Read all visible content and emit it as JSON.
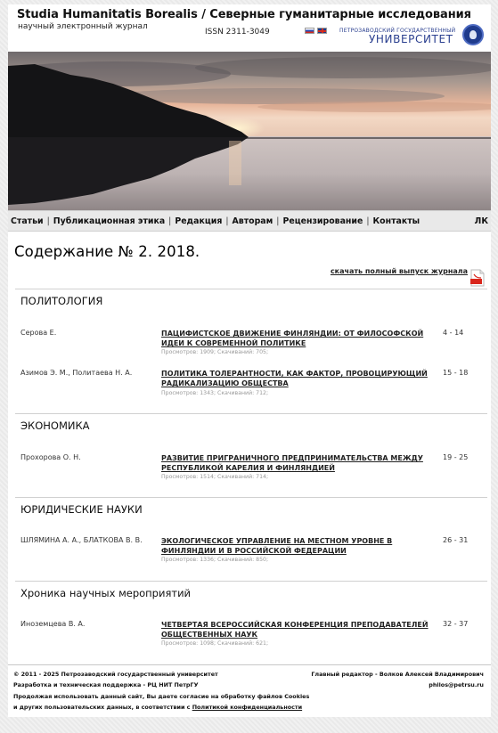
{
  "header": {
    "title": "Studia Humanitatis Borealis / Северные гуманитарные исследования",
    "subtitle": "научный электронный журнал",
    "issn": "ISSN 2311-3049",
    "university_line1": "ПЕТРОЗАВОДСКИЙ ГОСУДАРСТВЕННЫЙ",
    "university_line2": "УНИВЕРСИТЕТ"
  },
  "nav": {
    "items": [
      "Статьи",
      "Публикационная этика",
      "Редакция",
      "Авторам",
      "Рецензирование",
      "Контакты"
    ],
    "separator": "|",
    "account": "ЛК"
  },
  "contents": {
    "title": "Содержание № 2. 2018.",
    "download_label": "скачать полный выпуск журнала"
  },
  "sections": [
    {
      "title": "ПОЛИТОЛОГИЯ",
      "articles": [
        {
          "authors": "Серова Е.",
          "title": "ПАЦИФИСТСКОЕ ДВИЖЕНИЕ ФИНЛЯНДИИ: ОТ ФИЛОСОФСКОЙ ИДЕИ К СОВРЕМЕННОЙ ПОЛИТИКЕ",
          "stats": "Просмотров: 1909; Скачиваний: 705;",
          "pages": "4 - 14"
        },
        {
          "authors": "Азимов Э. М., Политаева Н. А.",
          "title": "ПОЛИТИКА ТОЛЕРАНТНОСТИ, КАК ФАКТОР, ПРОВОЦИРУЮЩИЙ РАДИКАЛИЗАЦИЮ ОБЩЕСТВА",
          "stats": "Просмотров: 1343; Скачиваний: 712;",
          "pages": "15 - 18"
        }
      ]
    },
    {
      "title": "ЭКОНОМИКА",
      "articles": [
        {
          "authors": "Прохорова О. Н.",
          "title": "РАЗВИТИЕ ПРИГРАНИЧНОГО ПРЕДПРИНИМАТЕЛЬСТВА МЕЖДУ РЕСПУБЛИКОЙ КАРЕЛИЯ И ФИНЛЯНДИЕЙ",
          "stats": "Просмотров: 1514; Скачиваний: 714;",
          "pages": "19 - 25"
        }
      ]
    },
    {
      "title": "ЮРИДИЧЕСКИЕ НАУКИ",
      "articles": [
        {
          "authors": "ШЛЯМИНА А. А., БЛАТКОВА В. В.",
          "title": "ЭКОЛОГИЧЕСКОЕ УПРАВЛЕНИЕ НА МЕСТНОМ УРОВНЕ В ФИНЛЯНДИИ И В РОССИЙСКОЙ ФЕДЕРАЦИИ",
          "stats": "Просмотров: 1336; Скачиваний: 850;",
          "pages": "26 - 31"
        }
      ]
    },
    {
      "title": "Хроника научных мероприятий",
      "articles": [
        {
          "authors": "Иноземцева В. А.",
          "title": "ЧЕТВЕРТАЯ ВСЕРОССИЙСКАЯ КОНФЕРЕНЦИЯ ПРЕПОДАВАТЕЛЕЙ ОБЩЕСТВЕННЫХ НАУК",
          "stats": "Просмотров: 1098; Скачиваний: 621;",
          "pages": "32 - 37"
        }
      ]
    }
  ],
  "footer": {
    "copyright": "© 2011 - 2025  Петрозаводский государственный университет",
    "support": "Разработка и техническая поддержка -  РЦ НИТ ПетрГУ",
    "cookies_line1": "Продолжая использовать данный сайт, Вы даете согласие на обработку файлов Cookies",
    "cookies_line2": "и других пользовательских данных, в соответствии с ",
    "privacy_link": "Политикой конфиденциальности",
    "editor": "Главный редактор - Волков Алексей Владимирович",
    "email": "philos@petrsu.ru"
  },
  "colors": {
    "university_blue": "#2a3f8f",
    "nav_background": "#e9e9e9",
    "pdf_red": "#d9261c"
  }
}
